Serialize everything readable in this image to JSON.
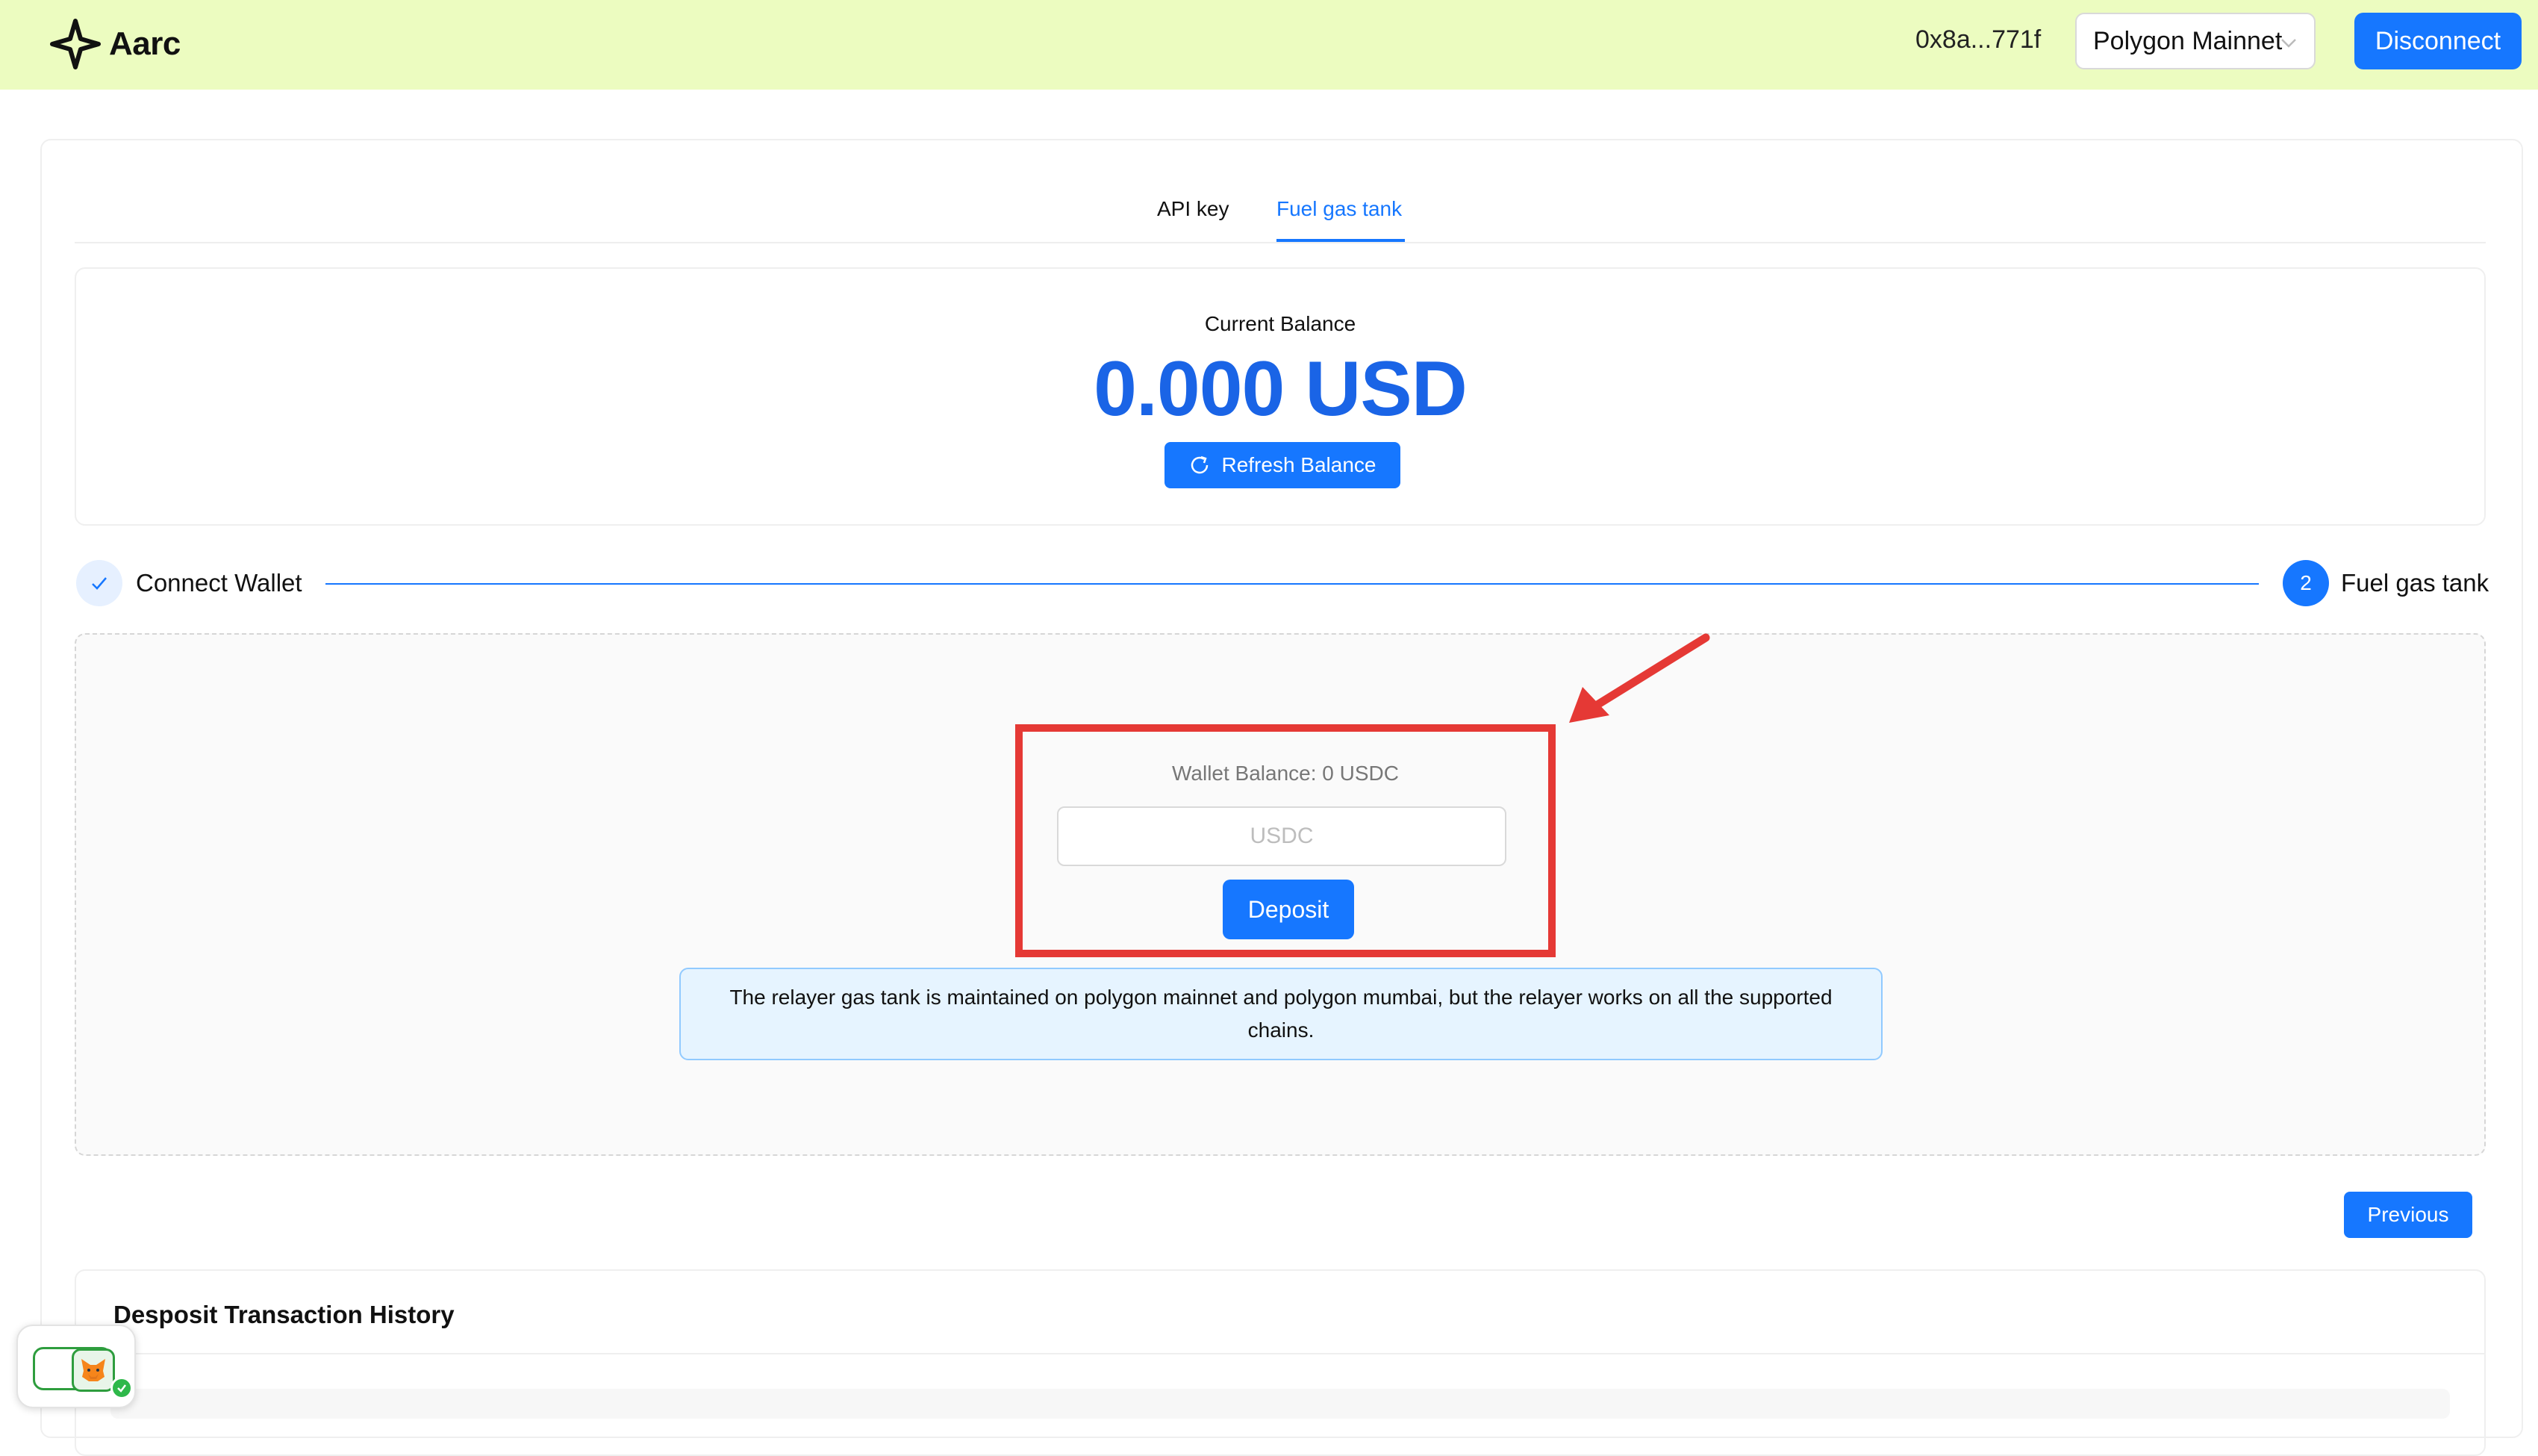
{
  "header": {
    "brand": "Aarc",
    "address": "0x8a...771f",
    "network": "Polygon Mainnet",
    "disconnect_label": "Disconnect"
  },
  "tabs": [
    {
      "label": "API key",
      "active": false
    },
    {
      "label": "Fuel gas tank",
      "active": true
    }
  ],
  "balance": {
    "label": "Current Balance",
    "value": "0.000 USD",
    "refresh_label": "Refresh Balance"
  },
  "steps": [
    {
      "label": "Connect Wallet",
      "status": "done"
    },
    {
      "number": "2",
      "label": "Fuel gas tank",
      "status": "current"
    }
  ],
  "deposit": {
    "wallet_balance": "Wallet Balance: 0 USDC",
    "input_placeholder": "USDC",
    "input_value": "",
    "button_label": "Deposit"
  },
  "info": {
    "line1": "The relayer gas tank is maintained on polygon mainnet and polygon mumbai, but the relayer works on all the supported",
    "line2": "chains."
  },
  "previous_label": "Previous",
  "history": {
    "title": "Desposit Transaction History"
  },
  "colors": {
    "header_bg": "#ecfcc0",
    "accent": "#1677ff",
    "balance_text": "#1a64e6",
    "highlight": "#e53935"
  },
  "icons": {
    "logo": "aarc-star-icon",
    "network_chevron": "chevron-down-icon",
    "refresh": "refresh-icon",
    "step_done": "check-icon",
    "annotation": "red-arrow-icon",
    "wallet_widget": "metamask-fox-icon"
  }
}
